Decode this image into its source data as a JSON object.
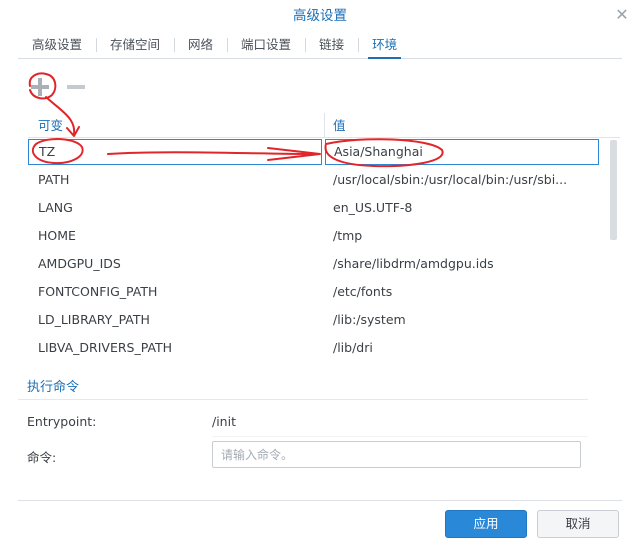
{
  "dialog": {
    "title": "高级设置"
  },
  "tabs": [
    {
      "label": "高级设置"
    },
    {
      "label": "存储空间"
    },
    {
      "label": "网络"
    },
    {
      "label": "端口设置"
    },
    {
      "label": "链接"
    },
    {
      "label": "环境",
      "active": true
    }
  ],
  "env_table": {
    "headers": {
      "variable": "可变",
      "value": "值"
    },
    "rows": [
      {
        "variable": "TZ",
        "value": "Asia/Shanghai"
      },
      {
        "variable": "PATH",
        "value": "/usr/local/sbin:/usr/local/bin:/usr/sbi..."
      },
      {
        "variable": "LANG",
        "value": "en_US.UTF-8"
      },
      {
        "variable": "HOME",
        "value": "/tmp"
      },
      {
        "variable": "AMDGPU_IDS",
        "value": "/share/libdrm/amdgpu.ids"
      },
      {
        "variable": "FONTCONFIG_PATH",
        "value": "/etc/fonts"
      },
      {
        "variable": "LD_LIBRARY_PATH",
        "value": "/lib:/system"
      },
      {
        "variable": "LIBVA_DRIVERS_PATH",
        "value": "/lib/dri"
      }
    ]
  },
  "exec": {
    "section_title": "执行命令",
    "entrypoint_label": "Entrypoint:",
    "entrypoint_value": "/init",
    "command_label": "命令:",
    "command_placeholder": "请输入命令。"
  },
  "footer": {
    "apply_label": "应用",
    "cancel_label": "取消"
  },
  "colors": {
    "accent": "#1c6fb5",
    "primary_button": "#2a88d8",
    "annotation": "#e0262b"
  },
  "icons": {
    "add": "plus-icon",
    "remove": "minus-icon",
    "close": "close-icon"
  }
}
